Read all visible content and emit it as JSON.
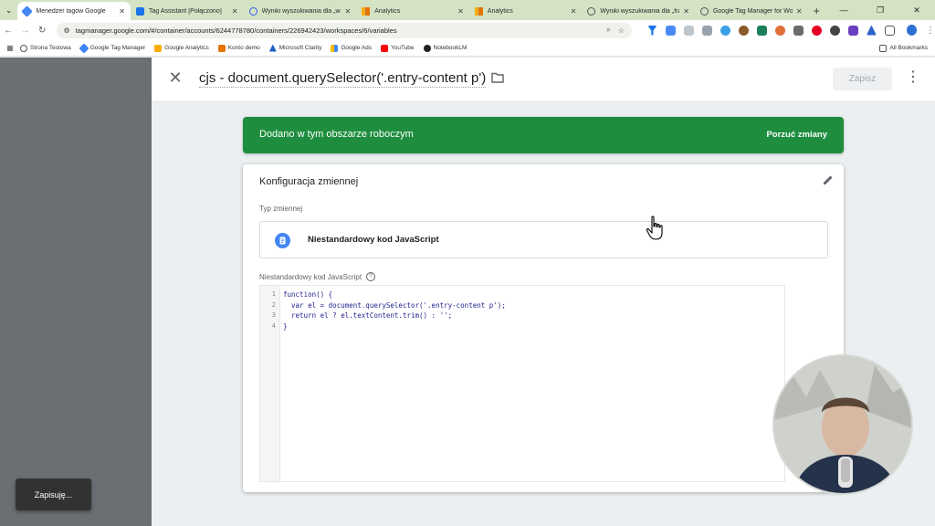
{
  "browser": {
    "tabs": [
      {
        "label": "Menedżer tagów Google",
        "active": true,
        "favicon": "gtm-icon"
      },
      {
        "label": "Tag Assistant [Połączono]",
        "active": false,
        "favicon": "tag-assistant-icon"
      },
      {
        "label": "Wyniki wyszukiwania dla „wał",
        "active": false,
        "favicon": "wordpress-icon"
      },
      {
        "label": "Analytics",
        "active": false,
        "favicon": "analytics-icon"
      },
      {
        "label": "Analytics",
        "active": false,
        "favicon": "analytics-icon"
      },
      {
        "label": "Wyniki wyszukiwania dla „fraz",
        "active": false,
        "favicon": "globe-icon"
      },
      {
        "label": "Google Tag Manager for Word",
        "active": false,
        "favicon": "globe-icon"
      }
    ],
    "url": "tagmanager.google.com/#/container/accounts/6244778780/containers/226942423/workspaces/6/variables",
    "bookmarks": [
      {
        "label": "Strona Testowa",
        "icon": "globe-icon"
      },
      {
        "label": "Google Tag Manager",
        "icon": "gtm-icon"
      },
      {
        "label": "Google Analytics",
        "icon": "analytics-icon"
      },
      {
        "label": "Konto demo",
        "icon": "analytics-icon"
      },
      {
        "label": "Microsoft Clarity",
        "icon": "clarity-icon"
      },
      {
        "label": "Google Ads",
        "icon": "google-ads-icon"
      },
      {
        "label": "YouTube",
        "icon": "youtube-icon"
      },
      {
        "label": "NotebookLM",
        "icon": "notebooklm-icon"
      }
    ],
    "all_bookmarks": "All Bookmarks"
  },
  "gtm": {
    "variable_title": "cjs - document.querySelector('.entry-content p')",
    "save_label": "Zapisz",
    "banner_text": "Dodano w tym obszarze roboczym",
    "banner_action": "Porzuć zmiany",
    "card_title": "Konfiguracja zmiennej",
    "type_label": "Typ zmiennej",
    "type_name": "Niestandardowy kod JavaScript",
    "code_label": "Niestandardowy kod JavaScript",
    "help_symbol": "?",
    "code": [
      {
        "n": "1",
        "text": "function() {"
      },
      {
        "n": "2",
        "text": "  var el = document.querySelector('.entry-content p');"
      },
      {
        "n": "3",
        "text": "  return el ? el.textContent.trim() : '';"
      },
      {
        "n": "4",
        "text": "}"
      }
    ]
  },
  "snackbar": "Zapisuję...",
  "colors": {
    "banner_green": "#1e8e3e",
    "tab_strip": "#d3e3c4",
    "gtm_blue": "#4285f4"
  }
}
